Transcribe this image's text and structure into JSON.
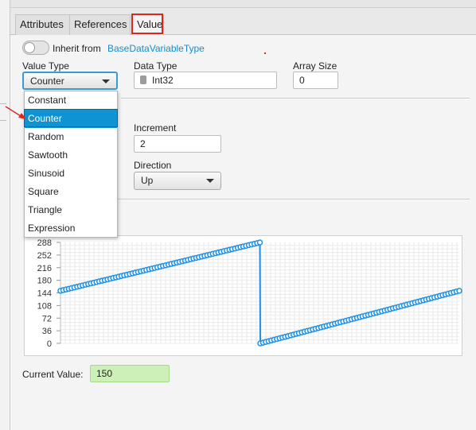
{
  "tabs": [
    "Attributes",
    "References",
    "Value"
  ],
  "active_tab": "Value",
  "inherit": {
    "label": "Inherit from",
    "link": "BaseDataVariableType"
  },
  "value_type": {
    "label": "Value Type",
    "selected": "Counter"
  },
  "data_type": {
    "label": "Data Type",
    "value": "Int32",
    "icon": "database-icon"
  },
  "array_size": {
    "label": "Array Size",
    "value": "0"
  },
  "increment": {
    "label": "Increment",
    "value": "2"
  },
  "direction": {
    "label": "Direction",
    "selected": "Up"
  },
  "dropdown_options": [
    "Constant",
    "Counter",
    "Random",
    "Sawtooth",
    "Sinusoid",
    "Square",
    "Triangle",
    "Expression"
  ],
  "current_value": {
    "label": "Current Value:",
    "value": "150"
  },
  "colors": {
    "accent": "#0f93d2",
    "series": "#1e90e6",
    "highlight": "#e0261b",
    "current_value_bg": "#cdf0b9"
  },
  "chart_data": {
    "type": "line",
    "y_ticks": [
      288,
      252,
      216,
      180,
      144,
      108,
      72,
      36,
      0
    ],
    "ylim": [
      0,
      288
    ],
    "grid": true,
    "series": [
      {
        "x": [
          0,
          50,
          50.1,
          100
        ],
        "y": [
          150,
          288,
          0,
          150
        ]
      }
    ],
    "markers": "circle"
  }
}
